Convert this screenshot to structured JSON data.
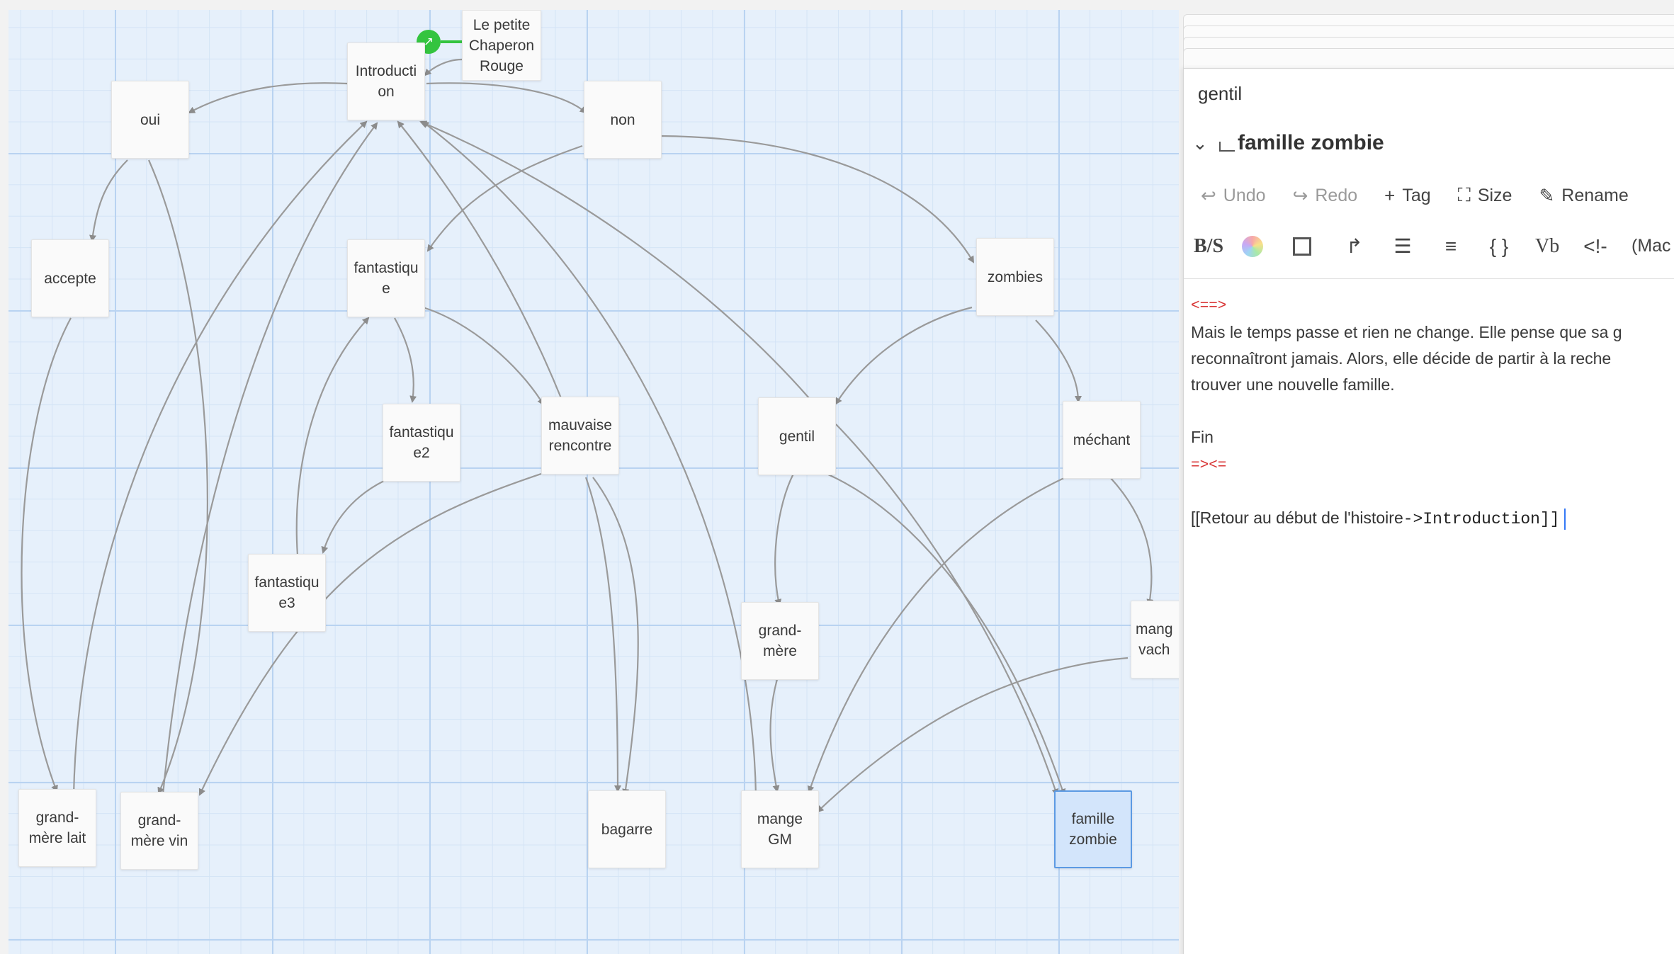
{
  "story_map": {
    "start_marker_icon": "rocket-icon",
    "passages": [
      {
        "id": "chaperon",
        "label": "Le petite\nChaperon\nRouge"
      },
      {
        "id": "introduction",
        "label": "Introducti\non"
      },
      {
        "id": "oui",
        "label": "oui"
      },
      {
        "id": "non",
        "label": "non"
      },
      {
        "id": "accepte",
        "label": "accepte"
      },
      {
        "id": "fantastique",
        "label": "fantastiqu\ne"
      },
      {
        "id": "zombies",
        "label": "zombies"
      },
      {
        "id": "fantastique2",
        "label": "fantastiqu\ne2"
      },
      {
        "id": "mauvaise",
        "label": "mauvaise\nrencontre"
      },
      {
        "id": "gentil",
        "label": "gentil"
      },
      {
        "id": "mechant",
        "label": "méchant"
      },
      {
        "id": "fantastique3",
        "label": "fantastiqu\ne3"
      },
      {
        "id": "grandmere",
        "label": "grand-\nmère"
      },
      {
        "id": "mangevache",
        "label": "mang\nvach"
      },
      {
        "id": "gmlait",
        "label": "grand-\nmère lait"
      },
      {
        "id": "gmvin",
        "label": "grand-\nmère vin"
      },
      {
        "id": "bagarre",
        "label": "bagarre"
      },
      {
        "id": "mangegm",
        "label": "mange\nGM"
      },
      {
        "id": "famillezombie",
        "label": "famille\nzombie",
        "selected": true
      }
    ]
  },
  "dialog": {
    "collapsed_title": "gentil",
    "title": "famille zombie",
    "toolbar": {
      "undo": "Undo",
      "redo": "Redo",
      "tag": "Tag",
      "size": "Size",
      "rename": "Rename"
    },
    "format_toolbar": {
      "strike": "B/S",
      "box": "",
      "bold_v": "Vb",
      "comment": "<!-",
      "macro": "(Mac"
    },
    "editor": {
      "open_hook": "<==>",
      "line1": "Mais le temps passe et rien ne change. Elle pense que sa g",
      "line2": "reconnaîtront jamais. Alors, elle décide de partir à la reche",
      "line3": "trouver une nouvelle famille.",
      "fin": "Fin",
      "close_hook": "=><=",
      "link_prefix": "[[Retour au début de l'histoire",
      "link_arrow": "->",
      "link_target": "Introduction",
      "link_suffix": "]]"
    }
  }
}
